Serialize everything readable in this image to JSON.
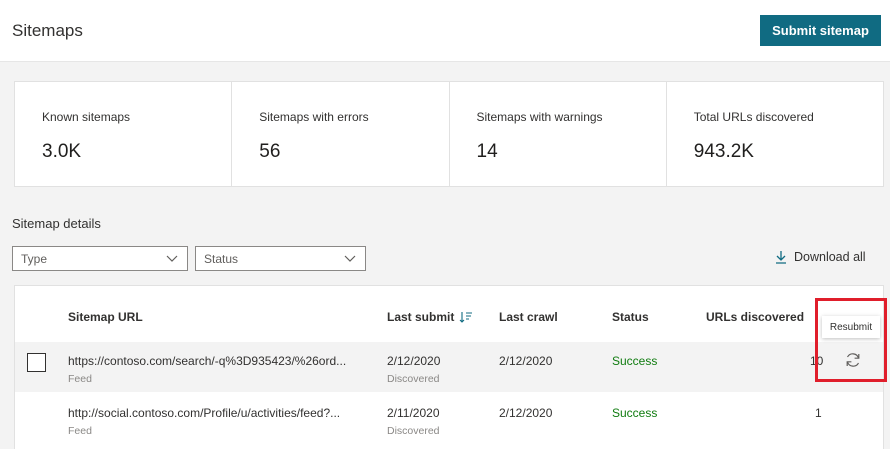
{
  "header": {
    "title": "Sitemaps",
    "submit_label": "Submit sitemap"
  },
  "summary": [
    {
      "label": "Known sitemaps",
      "value": "3.0K"
    },
    {
      "label": "Sitemaps with errors",
      "value": "56"
    },
    {
      "label": "Sitemaps with warnings",
      "value": "14"
    },
    {
      "label": "Total URLs discovered",
      "value": "943.2K"
    }
  ],
  "details": {
    "title": "Sitemap details",
    "type_placeholder": "Type",
    "status_placeholder": "Status",
    "download_label": "Download all"
  },
  "table": {
    "columns": [
      "Sitemap URL",
      "Last submit",
      "Last crawl",
      "Status",
      "URLs discovered"
    ],
    "rows": [
      {
        "url": "https://contoso.com/search/-q%3D935423/%26ord...",
        "type": "Feed",
        "last_submit": "2/12/2020",
        "submit_sub": "Discovered",
        "last_crawl": "2/12/2020",
        "status": "Success",
        "urls": "10"
      },
      {
        "url": "http://social.contoso.com/Profile/u/activities/feed?...",
        "type": "Feed",
        "last_submit": "2/11/2020",
        "submit_sub": "Discovered",
        "last_crawl": "2/12/2020",
        "status": "Success",
        "urls": "1"
      }
    ]
  },
  "tooltip": "Resubmit",
  "colors": {
    "accent": "#106b82",
    "success": "#107c10",
    "highlight": "#e01e2b"
  }
}
